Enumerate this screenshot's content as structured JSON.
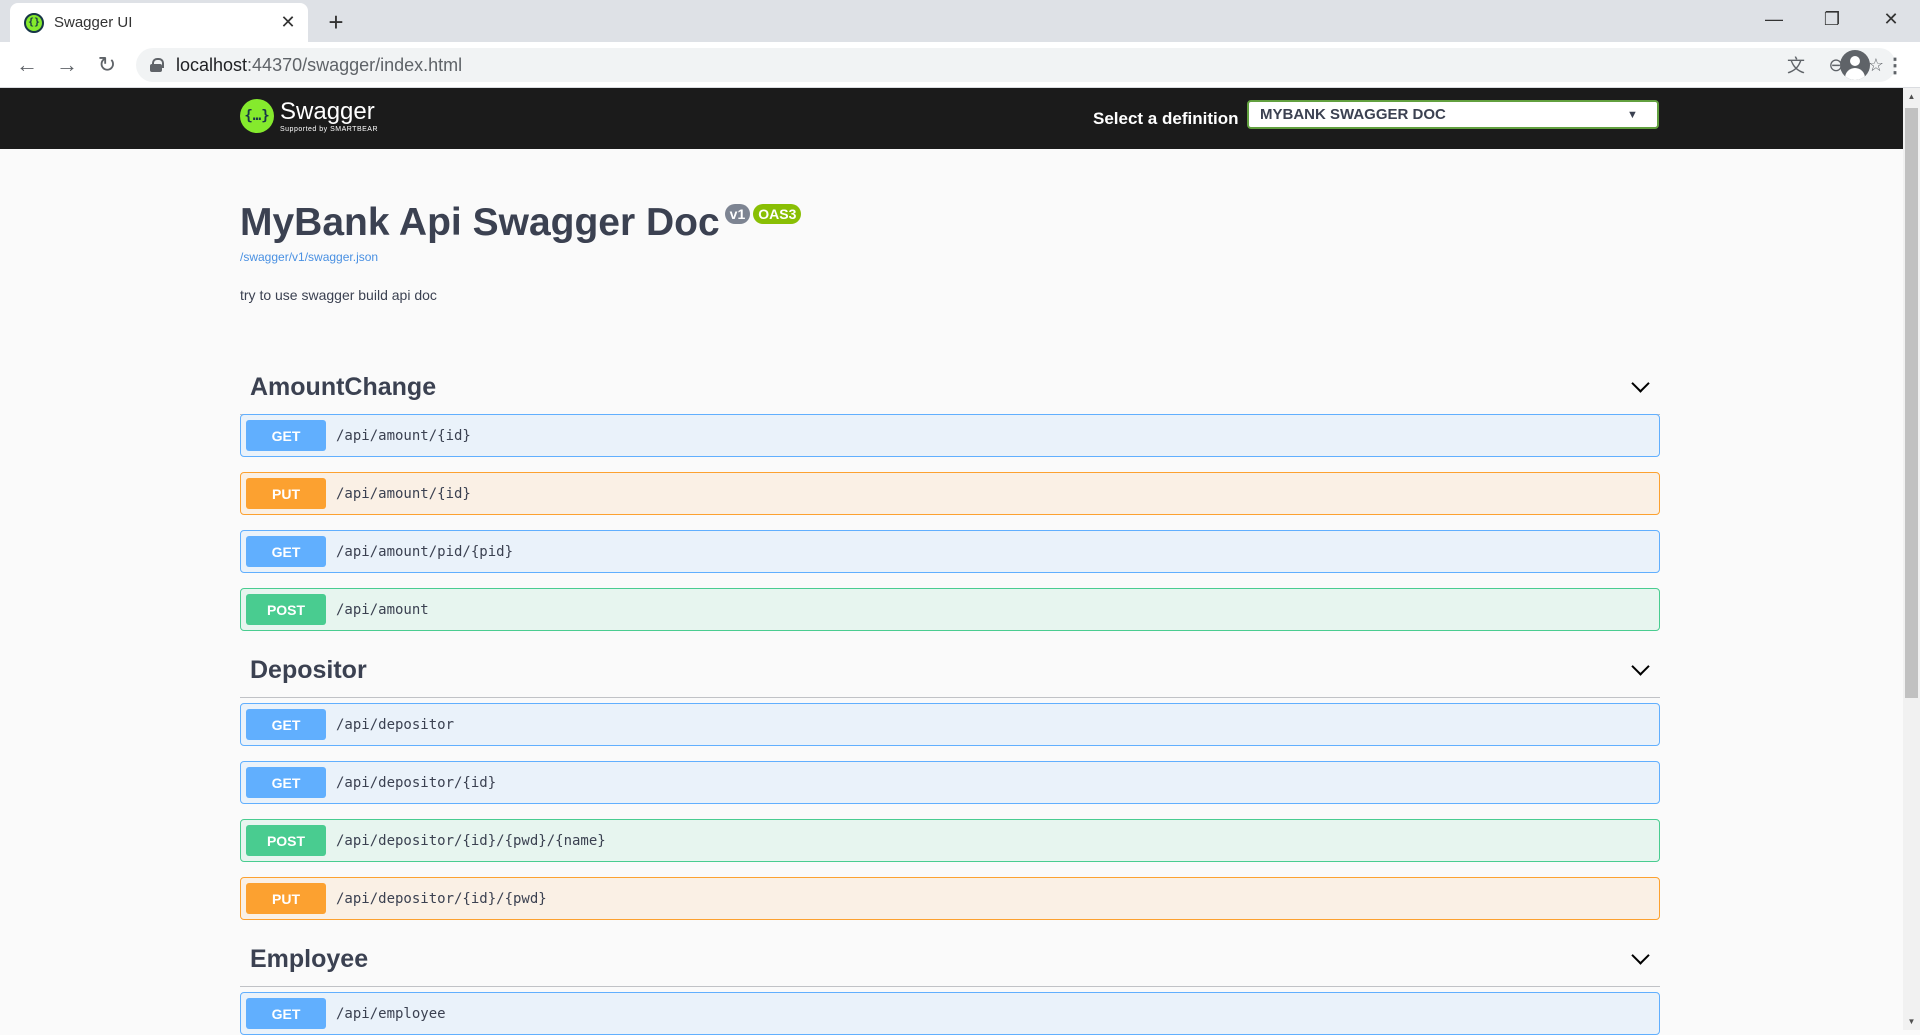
{
  "browser": {
    "tab_title": "Swagger UI",
    "url_host": "localhost",
    "url_path": ":44370/swagger/index.html"
  },
  "topbar": {
    "logo_name": "Swagger",
    "logo_sub": "Supported by SMARTBEAR",
    "select_label": "Select a definition",
    "select_value": "MYBANK SWAGGER DOC"
  },
  "info": {
    "title": "MyBank Api Swagger Doc",
    "version_badge": "v1",
    "oas_badge": "OAS3",
    "spec_link": "/swagger/v1/swagger.json",
    "description": "try to use swagger build api doc"
  },
  "tags": [
    {
      "name": "AmountChange",
      "operations": [
        {
          "method": "GET",
          "path": "/api/amount/{id}"
        },
        {
          "method": "PUT",
          "path": "/api/amount/{id}"
        },
        {
          "method": "GET",
          "path": "/api/amount/pid/{pid}"
        },
        {
          "method": "POST",
          "path": "/api/amount"
        }
      ]
    },
    {
      "name": "Depositor",
      "operations": [
        {
          "method": "GET",
          "path": "/api/depositor"
        },
        {
          "method": "GET",
          "path": "/api/depositor/{id}"
        },
        {
          "method": "POST",
          "path": "/api/depositor/{id}/{pwd}/{name}"
        },
        {
          "method": "PUT",
          "path": "/api/depositor/{id}/{pwd}"
        }
      ]
    },
    {
      "name": "Employee",
      "operations": [
        {
          "method": "GET",
          "path": "/api/employee"
        }
      ]
    }
  ],
  "colors": {
    "get": "#61affe",
    "put": "#fca130",
    "post": "#49cc90",
    "topbar": "#1b1b1b",
    "brand": "#85ea2d"
  }
}
